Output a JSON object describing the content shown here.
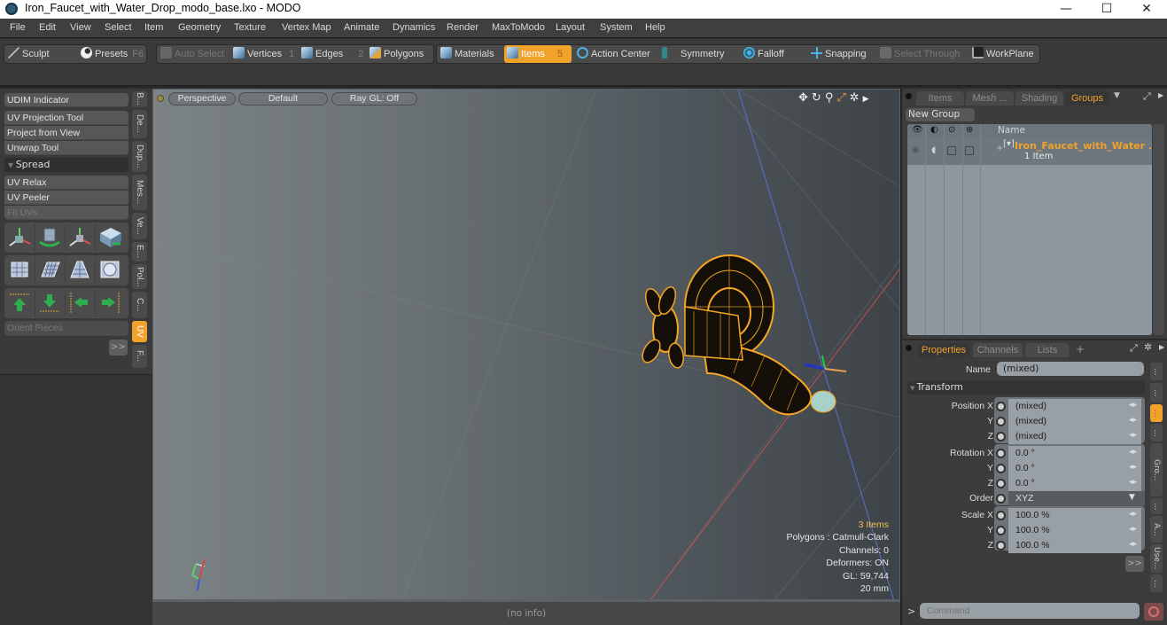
{
  "window": {
    "title": "Iron_Faucet_with_Water_Drop_modo_base.lxo - MODO",
    "minimize": "—",
    "maximize": "☐",
    "close": "✕"
  },
  "menu": [
    "File",
    "Edit",
    "View",
    "Select",
    "Item",
    "Geometry",
    "Texture",
    "Vertex Map",
    "Animate",
    "Dynamics",
    "Render",
    "MaxToModo",
    "Layout",
    "System",
    "Help"
  ],
  "toolbar": {
    "sculpt": "Sculpt",
    "presets": "Presets",
    "presets_key": "F6",
    "auto_select": "Auto Select",
    "vertices": "Vertices",
    "vertices_key": "1",
    "edges": "Edges",
    "edges_key": "2",
    "polygons": "Polygons",
    "materials": "Materials",
    "items": "Items",
    "items_key": "5",
    "action_center": "Action Center",
    "symmetry": "Symmetry",
    "falloff": "Falloff",
    "snapping": "Snapping",
    "select_through": "Select Through",
    "workplane": "WorkPlane"
  },
  "left_panel": {
    "udim": "UDIM Indicator",
    "uv_projection": "UV Projection Tool",
    "project_from_view": "Project from View",
    "unwrap": "Unwrap Tool",
    "spread_section": "Spread",
    "uv_relax": "UV Relax",
    "uv_peeler": "UV Peeler",
    "fit_uvs": "Fit UVs",
    "orient_pieces": "Orient Pieces",
    "more": ">>",
    "vtabs": [
      "B...",
      "De...",
      "Dup...",
      "Mes...",
      "Ve...",
      "E...",
      "Pol...",
      "C...",
      "UV",
      "F..."
    ],
    "active_vtab": "UV"
  },
  "viewport": {
    "view": "Perspective",
    "shading": "Default",
    "raygl": "Ray GL: Off",
    "info": {
      "items": "3 Items",
      "polygons": "Polygons : Catmull-Clark",
      "channels": "Channels: 0",
      "deformers": "Deformers: ON",
      "gl": "GL: 59,744",
      "scale": "20 mm"
    },
    "status": "(no info)"
  },
  "groups_panel": {
    "tabs": [
      "Items",
      "Mesh ...",
      "Shading",
      "Groups"
    ],
    "active_tab": "Groups",
    "new_group": "New Group",
    "col_name": "Name",
    "row": {
      "name": "Iron_Faucet_with_Water ...",
      "sub": "1 Item"
    }
  },
  "properties_panel": {
    "tabs": [
      "Properties",
      "Channels",
      "Lists",
      "+"
    ],
    "active_tab": "Properties",
    "name_label": "Name",
    "name_value": "(mixed)",
    "transform_section": "Transform",
    "rows": [
      {
        "label": "Position X",
        "value": "(mixed)"
      },
      {
        "label": "Y",
        "value": "(mixed)"
      },
      {
        "label": "Z",
        "value": "(mixed)"
      },
      {
        "label": "Rotation X",
        "value": "0.0 °"
      },
      {
        "label": "Y",
        "value": "0.0 °"
      },
      {
        "label": "Z",
        "value": "0.0 °"
      },
      {
        "label": "Order",
        "value": "XYZ"
      },
      {
        "label": "Scale X",
        "value": "100.0 %"
      },
      {
        "label": "Y",
        "value": "100.0 %"
      },
      {
        "label": "Z",
        "value": "100.0 %"
      }
    ],
    "more": ">>",
    "side_tabs": [
      "...",
      "...",
      "...",
      "...",
      "Gro...",
      "...",
      "A...",
      "Use...",
      "..."
    ]
  },
  "command": {
    "prompt": ">",
    "placeholder": "Command"
  },
  "colors": {
    "accent": "#f1a22a",
    "wire": "#f5a623"
  }
}
